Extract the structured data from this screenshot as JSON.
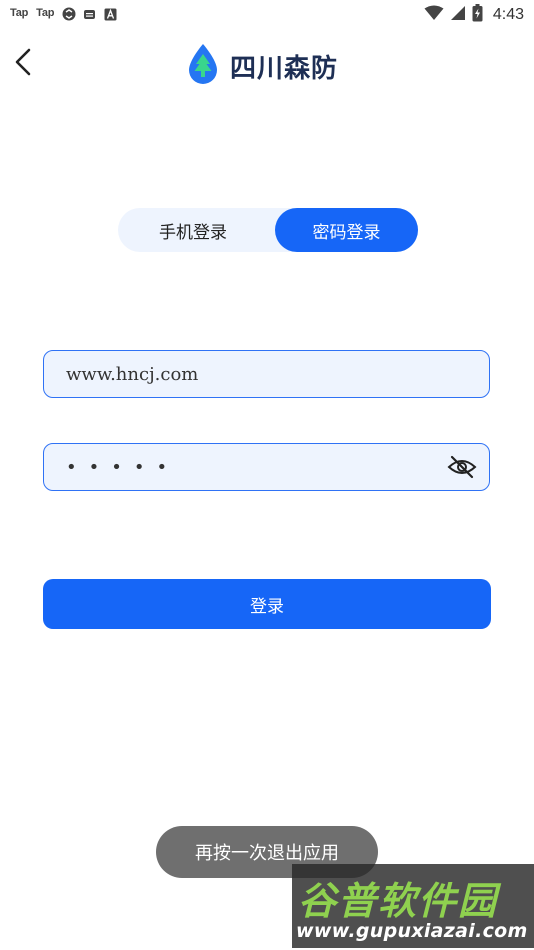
{
  "status_bar": {
    "left_labels": [
      "Tap",
      "Tap"
    ],
    "time": "4:43",
    "icons": [
      "taptap-icon",
      "taptap-icon",
      "sync-icon",
      "message-icon",
      "font-icon",
      "wifi-icon",
      "signal-icon",
      "battery-icon"
    ]
  },
  "header": {
    "title": "四川森防",
    "back_icon": "chevron-left-icon",
    "logo_icon": "tree-drop-logo-icon"
  },
  "tabs": [
    {
      "label": "手机登录",
      "active": false
    },
    {
      "label": "密码登录",
      "active": true
    }
  ],
  "form": {
    "username_value": "www.hncj.com",
    "password_dots": "•••••",
    "password_toggle_icon": "eye-off-icon",
    "submit_label": "登录"
  },
  "toast": {
    "message": "再按一次退出应用"
  },
  "watermark": {
    "title": "谷普软件园",
    "url": "www.gupuxiazai.com"
  },
  "colors": {
    "accent": "#1666f7",
    "field_bg": "#eef4fe",
    "field_border": "#2f72f5",
    "title": "#1e2f55",
    "toast_bg": "#6f6f6f",
    "watermark_green": "#8fd14f"
  }
}
